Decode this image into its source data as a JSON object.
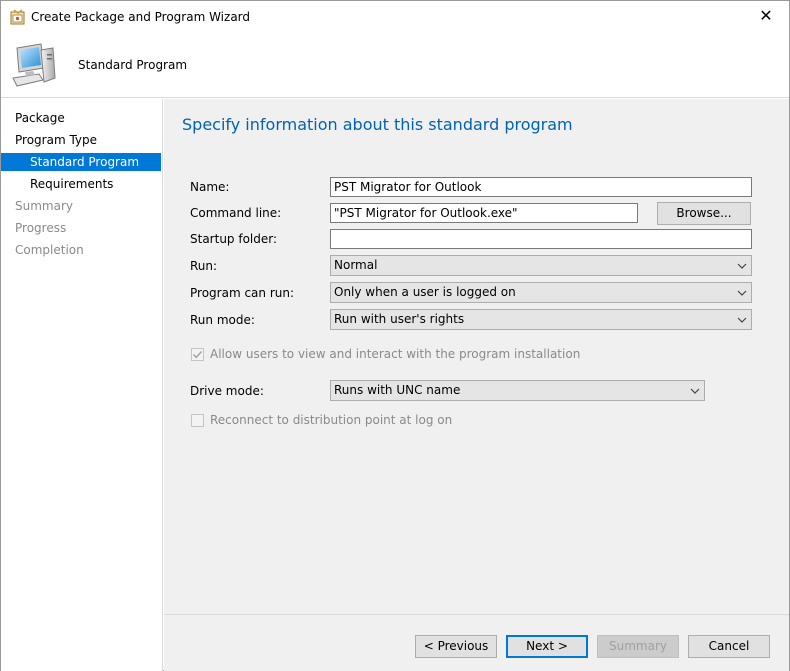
{
  "window": {
    "title": "Create Package and Program Wizard",
    "close_glyph": "✕"
  },
  "header": {
    "title": "Standard Program"
  },
  "nav": {
    "items": [
      {
        "label": "Package",
        "state": "normal"
      },
      {
        "label": "Program Type",
        "state": "normal"
      },
      {
        "label": "Standard Program",
        "state": "active"
      },
      {
        "label": "Requirements",
        "state": "normal"
      },
      {
        "label": "Summary",
        "state": "disabled"
      },
      {
        "label": "Progress",
        "state": "disabled"
      },
      {
        "label": "Completion",
        "state": "disabled"
      }
    ]
  },
  "main": {
    "heading": "Specify information about this standard program",
    "name_label": "Name:",
    "name_value": "PST Migrator for Outlook",
    "command_label": "Command line:",
    "command_value": "\"PST Migrator for Outlook.exe\"",
    "browse_label": "Browse...",
    "startup_label": "Startup folder:",
    "startup_value": "",
    "run_label": "Run:",
    "run_value": "Normal",
    "can_run_label": "Program can run:",
    "can_run_value": "Only when a user is logged on",
    "run_mode_label": "Run mode:",
    "run_mode_value": "Run with user's rights",
    "allow_interact_label": "Allow users to view and interact with the program installation",
    "allow_interact_checked": true,
    "drive_mode_label": "Drive mode:",
    "drive_mode_value": "Runs with UNC name",
    "reconnect_label": "Reconnect to distribution point at log on",
    "reconnect_checked": false
  },
  "footer": {
    "previous_label": "< Previous",
    "next_label": "Next >",
    "summary_label": "Summary",
    "cancel_label": "Cancel"
  },
  "colors": {
    "accent": "#0078d7",
    "heading": "#0063b1",
    "content_bg": "#f0f0f0"
  }
}
